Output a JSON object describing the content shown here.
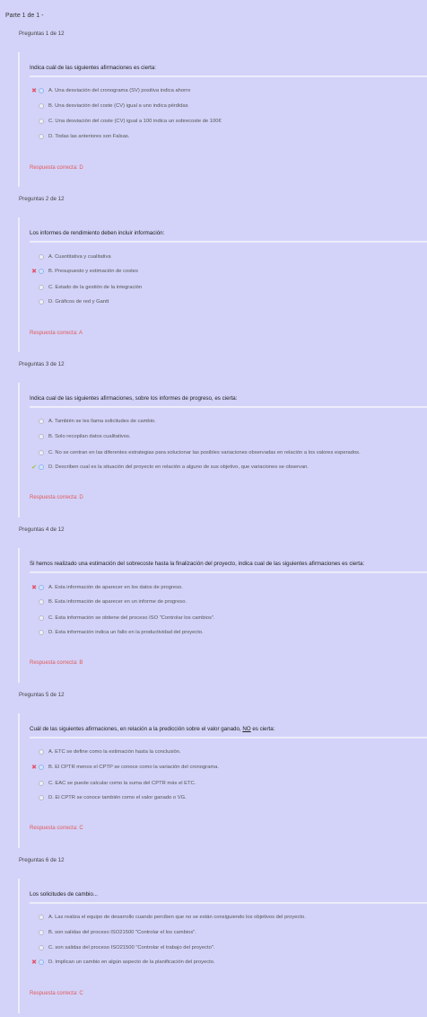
{
  "part_title": "Parte 1 de 1 -",
  "questions": [
    {
      "header": "Preguntas 1 de 12",
      "text": "Indica cuál de las siguientes afirmaciones es cierta:",
      "options": [
        {
          "text": "A. Una desviación del cronograma (SV) positiva indica ahorro",
          "mark": "x",
          "selected": true
        },
        {
          "text": "B. Una desviación del coste (CV) igual a uno indica pérdidas",
          "mark": "",
          "selected": false
        },
        {
          "text": "C. Una desviación del coste (CV) igual a 100 indica un sobrecoste de 100€",
          "mark": "",
          "selected": false
        },
        {
          "text": "D. Todas las anteriores son Falsas.",
          "mark": "",
          "selected": false
        }
      ],
      "answer": "Respuesta correcta: D"
    },
    {
      "header": "Preguntas 2 de 12",
      "text": "Los informes de rendimiento deben incluir información:",
      "options": [
        {
          "text": "A. Cuantitativa y cualitativa",
          "mark": "",
          "selected": false
        },
        {
          "text": "B. Presupuesto y estimación de costes",
          "mark": "x",
          "selected": true
        },
        {
          "text": "C. Estado de la gestión de la integración",
          "mark": "",
          "selected": false
        },
        {
          "text": "D. Gráficos de red y Gantt",
          "mark": "",
          "selected": false
        }
      ],
      "answer": "Respuesta correcta: A"
    },
    {
      "header": "Preguntas 3 de 12",
      "text": "Indica cual de las siguientes afirmaciones, sobre los informes de progreso, es cierta:",
      "options": [
        {
          "text": "A. También se les llama solicitudes de cambio.",
          "mark": "",
          "selected": false
        },
        {
          "text": "B. Solo recopilan datos cualitativos.",
          "mark": "",
          "selected": false
        },
        {
          "text": "C. No se centran en las diferentes estrategias para solucionar las posibles variaciones observadas en relación a los valores esperados.",
          "mark": "",
          "selected": false
        },
        {
          "text": "D. Describen cual es la situación del proyecto en relación a alguno de sus objetivo, que variaciones se observan.",
          "mark": "check",
          "selected": true
        }
      ],
      "answer": "Respuesta correcta: D"
    },
    {
      "header": "Preguntas 4 de 12",
      "text": "Si hemos realizado una estimación del sobrecoste hasta la finalización del proyecto, indica cual de las siguientes afirmaciones es cierta:",
      "options": [
        {
          "text": "A. Esta información de aparecer en los datos de progreso.",
          "mark": "x",
          "selected": true
        },
        {
          "text": "B. Esta información de aparecer en un informe de progreso.",
          "mark": "",
          "selected": false
        },
        {
          "text": "C. Esta información se obtiene del proceso ISO \"Controlar los cambios\".",
          "mark": "",
          "selected": false
        },
        {
          "text": "D. Esta información indica un fallo en la productividad del proyecto.",
          "mark": "",
          "selected": false
        }
      ],
      "answer": "Respuesta correcta: B"
    },
    {
      "header": "Preguntas 5 de 12",
      "text_before": "Cuál de las siguientes afirmaciones, en relación a la predicción sobre el valor ganado, ",
      "text_underline": "NO",
      "text_after": " es cierta:",
      "options": [
        {
          "text": "A. ETC se define como la estimación hasta la conclusión.",
          "mark": "",
          "selected": false
        },
        {
          "text": "B. El CPTR menos el CPTP se conoce como la variación del cronograma.",
          "mark": "x",
          "selected": true
        },
        {
          "text": "C. EAC se puede calcular como la suma del CPTR más el ETC.",
          "mark": "",
          "selected": false
        },
        {
          "text": "D. El CPTR se conoce también como el valor ganado o VG.",
          "mark": "",
          "selected": false
        }
      ],
      "answer": "Respuesta correcta: C"
    },
    {
      "header": "Preguntas 6 de 12",
      "text": "Los solicitudes de cambio...",
      "options": [
        {
          "text": "A. Las realiza el equipo de desarrollo cuando perciben que no se están consiguiendo los objetivos del proyecto.",
          "mark": "",
          "selected": false
        },
        {
          "text": "B. son salidas del proceso ISO21500 \"Controlar el los cambios\".",
          "mark": "",
          "selected": false
        },
        {
          "text": "C. son salidas del proceso ISO21500 \"Controlar el trabajo del proyecto\".",
          "mark": "",
          "selected": false
        },
        {
          "text": "D. Implican un cambio en algún aspecto de la planificación del proyecto.",
          "mark": "x",
          "selected": true
        }
      ],
      "answer": "Respuesta correcta: C"
    }
  ],
  "icons": {
    "x": "✖",
    "check": "✔"
  },
  "colors": {
    "background": "#d3d3f9",
    "panel_line": "#ececfb",
    "answer": "#e05a5a",
    "wrong": "#e0556a",
    "right": "#9bc43e"
  }
}
